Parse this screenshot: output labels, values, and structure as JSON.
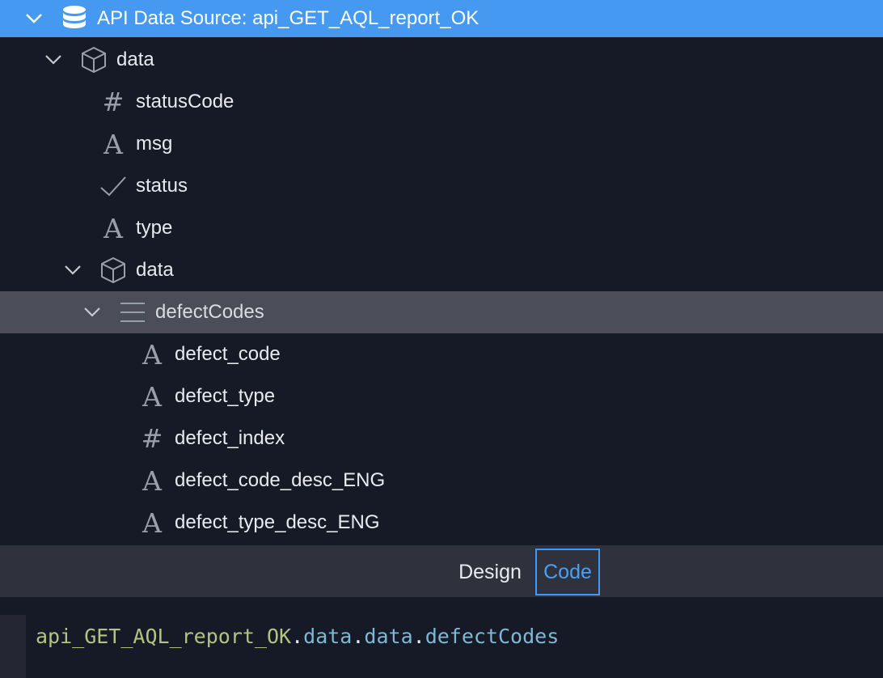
{
  "tree": {
    "root": {
      "label": "API Data Source: api_GET_AQL_report_OK",
      "icon": "database-icon"
    },
    "items": [
      {
        "label": "data",
        "icon": "cube-icon",
        "expanded": true
      },
      {
        "label": "statusCode",
        "icon": "hash-icon"
      },
      {
        "label": "msg",
        "icon": "text-icon"
      },
      {
        "label": "status",
        "icon": "check-icon"
      },
      {
        "label": "type",
        "icon": "text-icon"
      },
      {
        "label": "data",
        "icon": "cube-icon",
        "expanded": true
      },
      {
        "label": "defectCodes",
        "icon": "list-icon",
        "expanded": true,
        "selected": true
      },
      {
        "label": "defect_code",
        "icon": "text-icon"
      },
      {
        "label": "defect_type",
        "icon": "text-icon"
      },
      {
        "label": "defect_index",
        "icon": "hash-icon"
      },
      {
        "label": "defect_code_desc_ENG",
        "icon": "text-icon"
      },
      {
        "label": "defect_type_desc_ENG",
        "icon": "text-icon"
      }
    ]
  },
  "tabs": {
    "design": "Design",
    "code": "Code",
    "active": "Code"
  },
  "editor": {
    "root": "api_GET_AQL_report_OK",
    "dot": ".",
    "path": [
      "data",
      "data",
      "defectCodes"
    ]
  },
  "colors": {
    "root_bg": "#4599f0",
    "selected_bg": "#4b4e58",
    "panel_bg": "#161a26",
    "tabbar_bg": "#2f323d",
    "code_root": "#b5c281",
    "code_prop": "#7fb8d4"
  }
}
